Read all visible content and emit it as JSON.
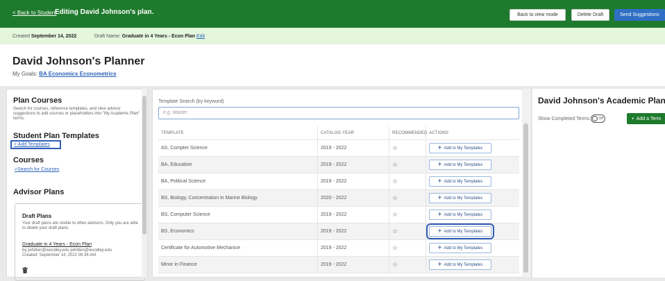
{
  "topbar": {
    "back_label": "< Back to Student",
    "title": "Editing David Johnson's plan.",
    "back_view_label": "Back to view mode",
    "delete_label": "Delete Draft",
    "send_label": "Send Suggestions"
  },
  "subbar": {
    "created_prefix": "Created",
    "created_date": "September 14, 2022",
    "draft_prefix": "Draft Name:",
    "draft_name": "Graduate in 4 Years - Econ Plan",
    "edit_label": "Edit"
  },
  "header": {
    "title": "David Johnson's Planner",
    "goals_prefix": "My Goals:",
    "goal_link": "BA Economics Econometrics"
  },
  "left": {
    "plan_courses_title": "Plan Courses",
    "plan_courses_desc": "Search for courses, reference templates, and view advisor suggestions to add courses or placeholders into \"My Academic Plan\" terms.",
    "templates_title": "Student Plan Templates",
    "add_templates": "+ Add Templates",
    "courses_title": "Courses",
    "search_courses": "Search for Courses",
    "advisor_plans_title": "Advisor Plans",
    "draft": {
      "title": "Draft Plans",
      "desc": "Your draft plans are visible to other advisors. Only you are able to delete your draft plans.",
      "plan_link": "Graduate in 4 Years - Econ Plan",
      "by_line": "by jwhitten@woodley.edu jwhitten@woodley.edu",
      "created_line": "Created: September 14, 2022 09:36 AM"
    }
  },
  "center": {
    "search_label": "Template Search (by keyword)",
    "search_placeholder": "e.g. Master",
    "columns": [
      "Template",
      "Catalog Year",
      "Recommended",
      "Actions"
    ],
    "add_label": "Add to My Templates",
    "rows": [
      {
        "template": "AS, Compter Science",
        "year": "2019 - 2022"
      },
      {
        "template": "BA, Education",
        "year": "2019 - 2022"
      },
      {
        "template": "BA, Political Science",
        "year": "2019 - 2022"
      },
      {
        "template": "BS, Biology, Concentration in Marine Biology",
        "year": "2020 - 2022"
      },
      {
        "template": "BS, Computer Science",
        "year": "2019 - 2022"
      },
      {
        "template": "BS, Economics",
        "year": "2019 - 2022"
      },
      {
        "template": "Certificate for Automotive Mechanice",
        "year": "2019 - 2022"
      },
      {
        "template": "Minor in Finance",
        "year": "2019 - 2022"
      }
    ]
  },
  "right": {
    "title": "David Johnson's Academic Plan",
    "show_completed": "Show Completed Terms",
    "toggle_state": "Off",
    "add_term": "Add a Term"
  },
  "colors": {
    "topbar_green": "#1e7a2c",
    "subbar_green": "#e4f6dc",
    "link_blue": "#2a63b8",
    "primary_blue": "#2f6fc4"
  }
}
